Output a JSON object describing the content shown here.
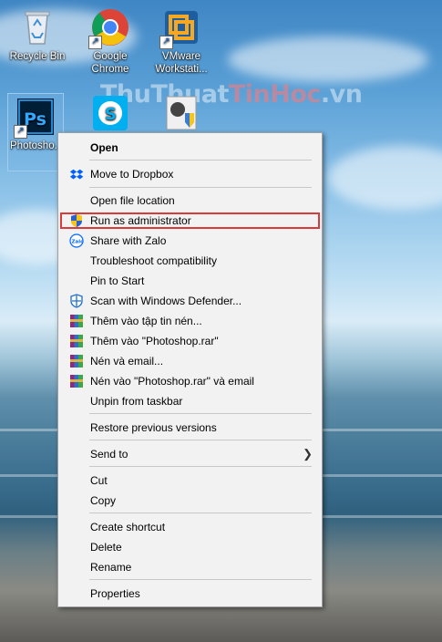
{
  "desktop": {
    "watermark": {
      "part1": "ThuThuat",
      "part2": "TinHoc",
      "part3": ".vn"
    },
    "icons": [
      {
        "id": "recycle",
        "label": "Recycle Bin"
      },
      {
        "id": "chrome",
        "label": "Google Chrome"
      },
      {
        "id": "vmware",
        "label": "VMware Workstati..."
      },
      {
        "id": "photoshop",
        "label": "Photosho... Shortcu..."
      }
    ]
  },
  "context_menu": {
    "items": [
      "Open",
      "Move to Dropbox",
      "Open file location",
      "Run as administrator",
      "Share with Zalo",
      "Troubleshoot compatibility",
      "Pin to Start",
      "Scan with Windows Defender...",
      "Thêm vào tập tin nén...",
      "Thêm vào \"Photoshop.rar\"",
      "Nén và email...",
      "Nén vào \"Photoshop.rar\" và email",
      "Unpin from taskbar",
      "Restore previous versions",
      "Send to",
      "Cut",
      "Copy",
      "Create shortcut",
      "Delete",
      "Rename",
      "Properties"
    ],
    "highlight_color": "#d93a3a"
  }
}
